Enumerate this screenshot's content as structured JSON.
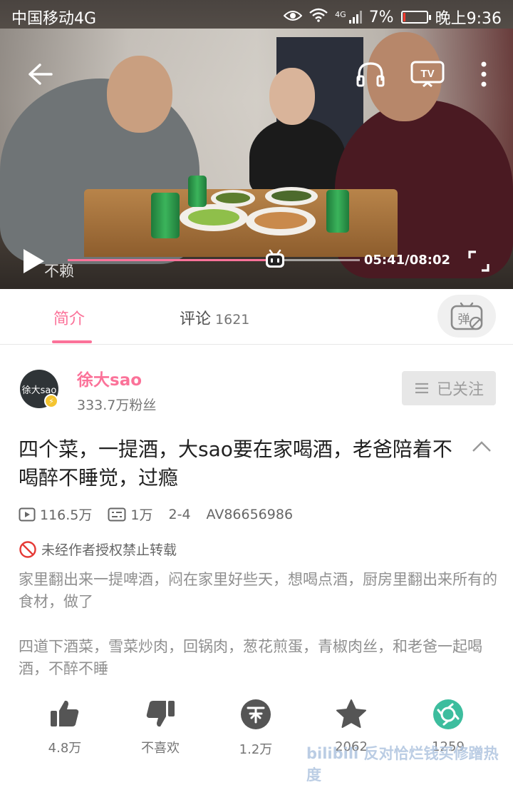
{
  "status_bar": {
    "carrier": "中国移动4G",
    "network": "4G",
    "battery": "7%",
    "battery_level": 0.07,
    "time": "晚上9:36"
  },
  "player": {
    "danmaku_text": "不赖",
    "time": "05:41/08:02",
    "progress": 0.709
  },
  "tabs": {
    "intro": "简介",
    "comments": "评论",
    "comments_count": "1621"
  },
  "uploader": {
    "name": "徐大sao",
    "avatar_text": "徐大sao",
    "fans": "333.7万粉丝",
    "follow_label": "已关注"
  },
  "video": {
    "title": "四个菜，一提酒，大sao要在家喝酒，老爸陪着不喝醉不睡觉，过瘾",
    "views": "116.5万",
    "danmaku_count": "1万",
    "date": "2-4",
    "av": "AV86656986",
    "forbid": "未经作者授权禁止转载",
    "description_1": "家里翻出来一提啤酒，闷在家里好些天，想喝点酒，厨房里翻出来所有的食材，做了",
    "description_2": "四道下酒菜，雪菜炒肉，回锅肉，葱花煎蛋，青椒肉丝，和老爸一起喝酒，不醉不睡"
  },
  "actions": {
    "like": "4.8万",
    "dislike": "不喜欢",
    "coin": "1.2万",
    "favorite": "2062",
    "share": "1259"
  },
  "watermark": "bilibili 反对恰烂钱买修蹭热度",
  "colors": {
    "accent": "#fb7299",
    "share_green": "#3dbd9e"
  }
}
